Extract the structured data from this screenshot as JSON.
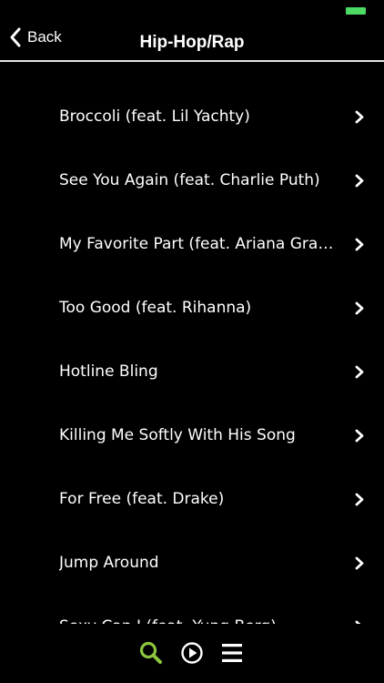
{
  "colors": {
    "background": "#000000",
    "text": "#ffffff",
    "accent": "#8cc63f",
    "battery": "#4cd964",
    "divider": "#e6e6e6"
  },
  "header": {
    "back_label": "Back",
    "title": "Hip-Hop/Rap"
  },
  "songs": [
    {
      "title": "Broccoli (feat. Lil Yachty)"
    },
    {
      "title": "See You Again (feat. Charlie Puth)"
    },
    {
      "title": "My Favorite Part (feat. Ariana Grande)"
    },
    {
      "title": "Too Good (feat. Rihanna)"
    },
    {
      "title": "Hotline Bling"
    },
    {
      "title": "Killing Me Softly With His Song"
    },
    {
      "title": "For Free (feat. Drake)"
    },
    {
      "title": "Jump Around"
    },
    {
      "title": "Sexy Can I (feat. Yung Berg)"
    }
  ],
  "tabbar": {
    "tabs": [
      {
        "icon": "search-icon",
        "active": true
      },
      {
        "icon": "play-circle-icon",
        "active": false
      },
      {
        "icon": "menu-icon",
        "active": false
      }
    ]
  }
}
